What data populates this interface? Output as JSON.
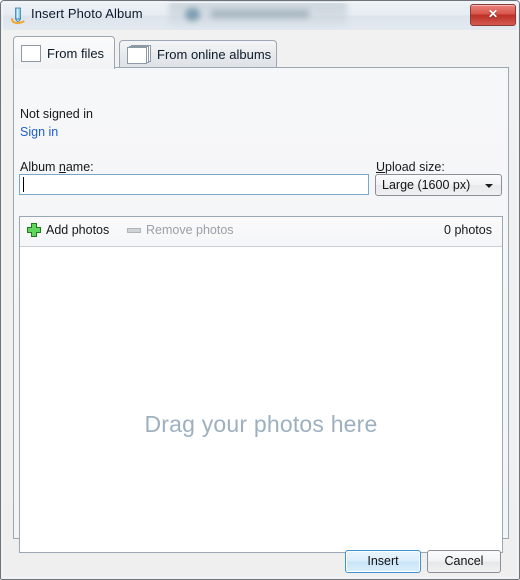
{
  "window": {
    "title": "Insert Photo Album",
    "title_icon": "pencil-swoosh-icon",
    "close_label": "✕"
  },
  "tabs": [
    {
      "label": "From files",
      "icon": "photo-icon",
      "active": true
    },
    {
      "label": "From online albums",
      "icon": "photo-stack-icon",
      "active": false
    }
  ],
  "account": {
    "status": "Not signed in",
    "signin_label": "Sign in",
    "link_color": "#1f5fcc"
  },
  "album": {
    "label": "Album name:",
    "value": "",
    "placeholder": ""
  },
  "upload": {
    "label": "Upload size:",
    "selected": "Large (1600 px)",
    "options": [
      "Large (1600 px)"
    ]
  },
  "photo_panel": {
    "add_label": "Add photos",
    "add_icon": "plus-icon",
    "remove_label": "Remove photos",
    "remove_icon": "minus-icon",
    "remove_disabled": true,
    "count_label": "0 photos",
    "drop_hint": "Drag your photos here",
    "drop_hint_color": "#9eb0c0"
  },
  "footer": {
    "insert_label": "Insert",
    "cancel_label": "Cancel",
    "default_button_accent": "#3c94d2"
  }
}
